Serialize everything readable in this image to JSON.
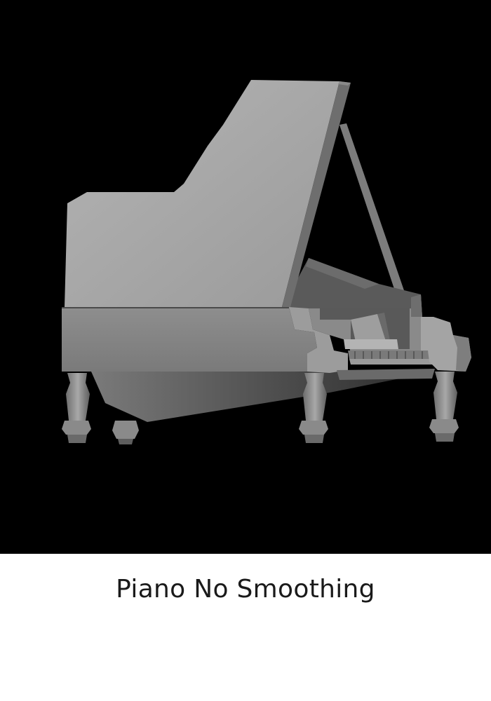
{
  "figure": {
    "caption": "Piano No Smoothing",
    "subject_icon": "grand-piano-render",
    "colors": {
      "background": "#000000",
      "caption_background": "#ffffff",
      "caption_text": "#1a1a1a"
    }
  }
}
